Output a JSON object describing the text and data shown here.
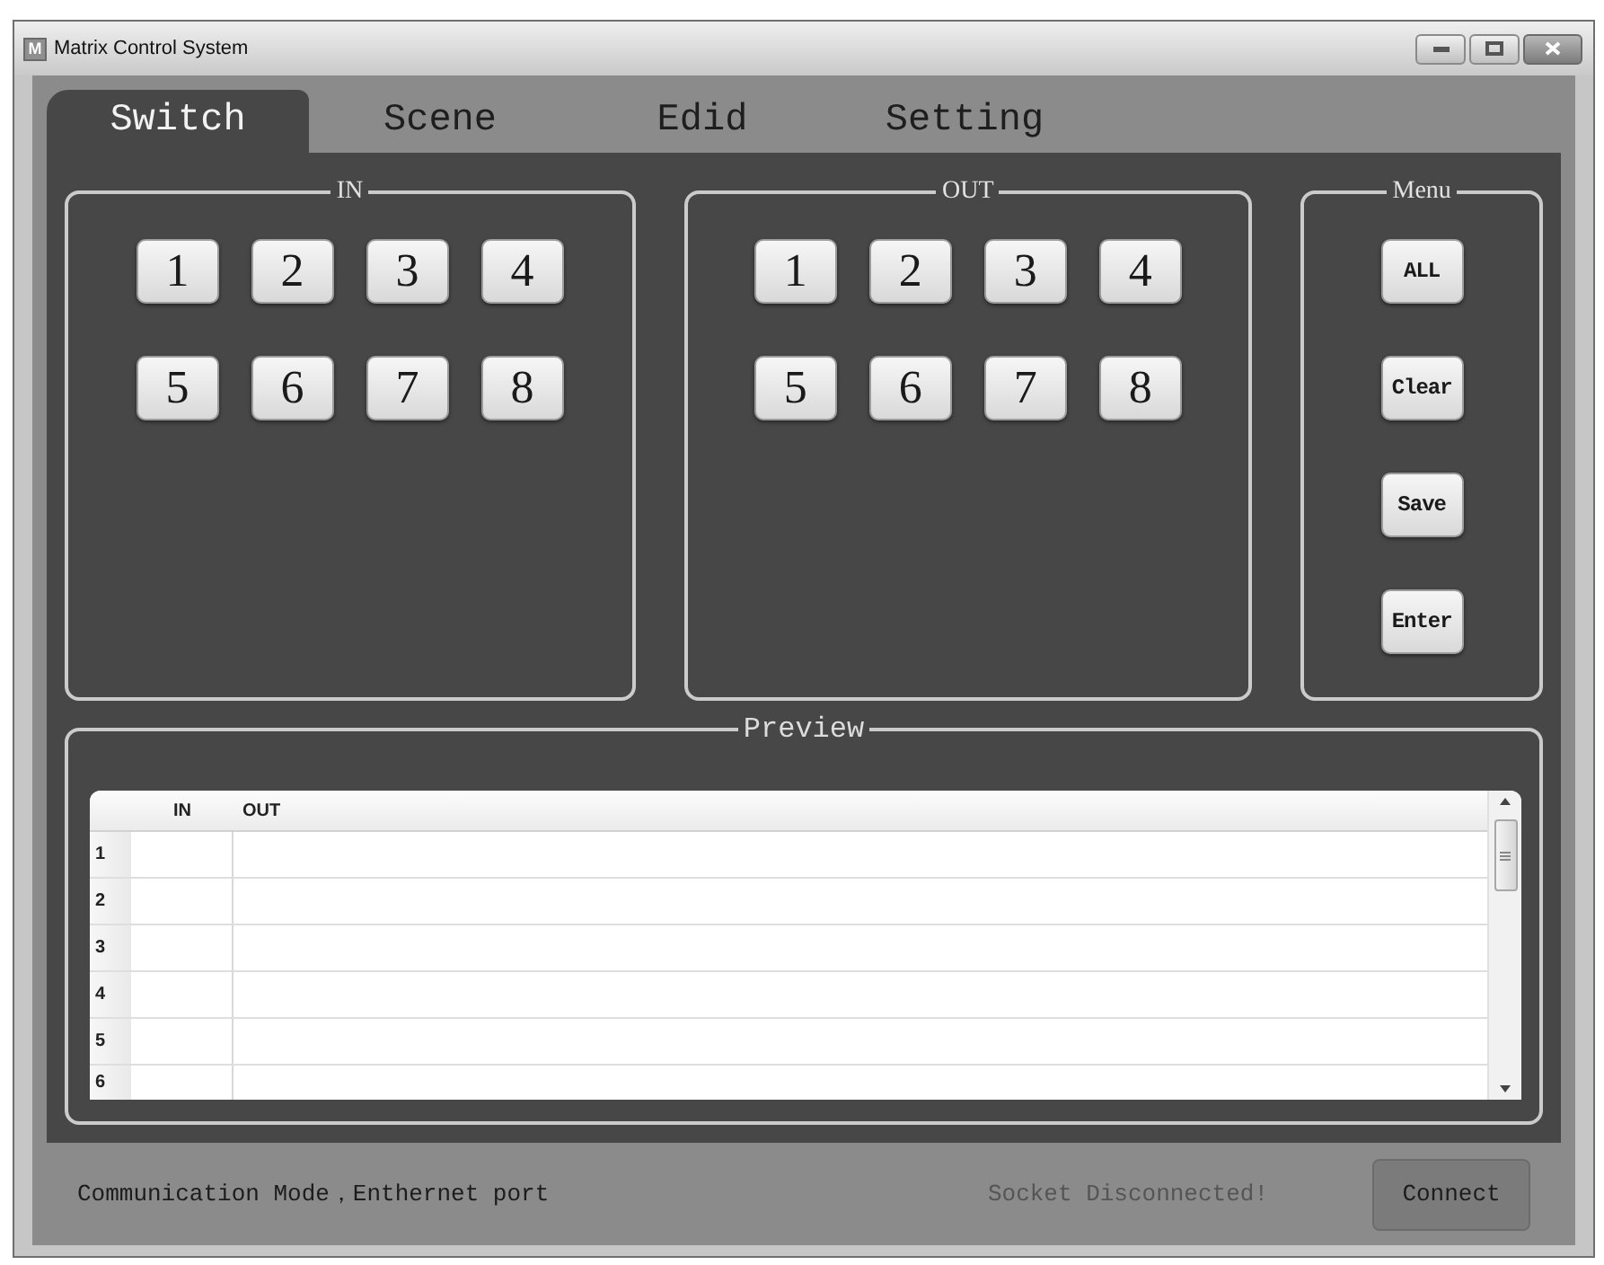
{
  "window": {
    "app_icon": "M",
    "title": "Matrix Control System"
  },
  "tabs": [
    {
      "label": "Switch",
      "selected": true
    },
    {
      "label": "Scene",
      "selected": false
    },
    {
      "label": "Edid",
      "selected": false
    },
    {
      "label": "Setting",
      "selected": false
    }
  ],
  "groups": [
    {
      "kind": "number_pad",
      "title": "IN",
      "buttons": [
        "1",
        "2",
        "3",
        "4",
        "5",
        "6",
        "7",
        "8"
      ]
    },
    {
      "kind": "number_pad",
      "title": "OUT",
      "buttons": [
        "1",
        "2",
        "3",
        "4",
        "5",
        "6",
        "7",
        "8"
      ]
    },
    {
      "kind": "menu",
      "title": "Menu",
      "buttons": [
        "ALL",
        "Clear",
        "Save",
        "Enter"
      ]
    }
  ],
  "preview": {
    "title": "Preview",
    "table": {
      "columns": [
        "IN",
        "OUT"
      ],
      "rows": [
        {
          "number": "1"
        },
        {
          "number": "2"
        },
        {
          "number": "3"
        },
        {
          "number": "4"
        },
        {
          "number": "5"
        },
        {
          "number": "6"
        }
      ]
    }
  },
  "status_bar": {
    "mode": "Communication Mode，Enthernet port",
    "connection": "Socket Disconnected!",
    "button": "Connect"
  }
}
